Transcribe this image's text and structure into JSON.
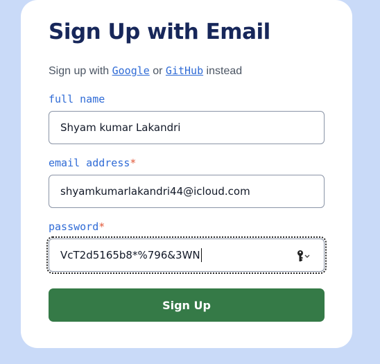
{
  "form": {
    "title": "Sign Up with Email",
    "alt_prefix": "Sign up with ",
    "alt_google": "Google",
    "alt_or": " or ",
    "alt_github": "GitHub",
    "alt_suffix": " instead",
    "full_name": {
      "label": "full name",
      "value": "Shyam kumar Lakandri"
    },
    "email": {
      "label": "email address",
      "required_mark": "*",
      "value": "shyamkumarlakandri44@icloud.com"
    },
    "password": {
      "label": "password",
      "required_mark": "*",
      "value": "VcT2d5165b8*%796&3WN"
    },
    "submit_label": "Sign Up"
  },
  "icons": {
    "password_manager": "key-icon"
  },
  "colors": {
    "page_background": "#c9daf8",
    "title": "#17275a",
    "label": "#2f6bd6",
    "required": "#e25a3b",
    "button": "#357a47"
  }
}
